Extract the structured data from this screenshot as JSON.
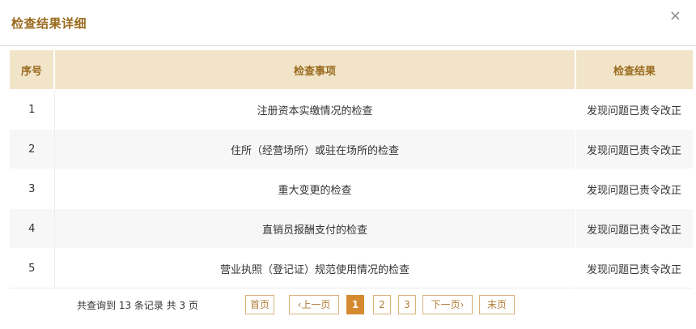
{
  "dialog": {
    "title": "检查结果详细",
    "close_label": "×"
  },
  "table": {
    "headers": [
      "序号",
      "检查事项",
      "检查结果"
    ],
    "rows": [
      {
        "no": "1",
        "item": "注册资本实缴情况的检查",
        "result": "发现问题已责令改正"
      },
      {
        "no": "2",
        "item": "住所（经营场所）或驻在场所的检查",
        "result": "发现问题已责令改正"
      },
      {
        "no": "3",
        "item": "重大变更的检查",
        "result": "发现问题已责令改正"
      },
      {
        "no": "4",
        "item": "直销员报酬支付的检查",
        "result": "发现问题已责令改正"
      },
      {
        "no": "5",
        "item": "营业执照（登记证）规范使用情况的检查",
        "result": "发现问题已责令改正"
      }
    ]
  },
  "pagination": {
    "summary": "共查询到 13 条记录 共 3 页",
    "first": "首页",
    "prev": "‹上一页",
    "pages": [
      "1",
      "2",
      "3"
    ],
    "active_page": "1",
    "next": "下一页›",
    "last": "末页"
  },
  "colors": {
    "accent": "#9a6b1f",
    "header_bg": "#f2e4c9",
    "active_page_bg": "#d58a32"
  }
}
